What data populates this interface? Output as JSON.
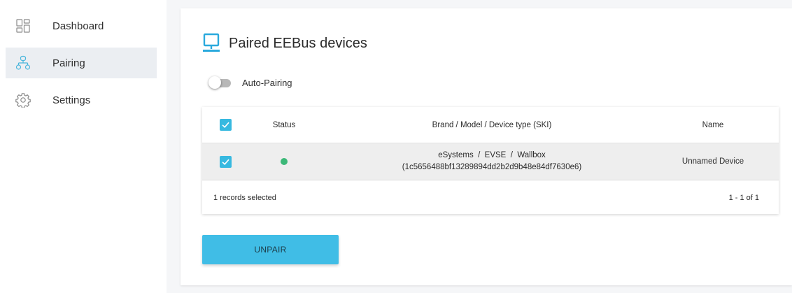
{
  "sidebar": {
    "items": [
      {
        "label": "Dashboard",
        "icon": "dashboard-icon",
        "active": false
      },
      {
        "label": "Pairing",
        "icon": "network-icon",
        "active": true
      },
      {
        "label": "Settings",
        "icon": "gear-icon",
        "active": false
      }
    ]
  },
  "main": {
    "title": "Paired EEBus devices",
    "title_icon": "monitor-icon",
    "auto_pairing": {
      "label": "Auto-Pairing",
      "enabled": false
    },
    "table": {
      "columns": [
        "Status",
        "Brand / Model / Device type (SKI)",
        "Name"
      ],
      "header_checked": true,
      "rows": [
        {
          "checked": true,
          "status_color": "#3cb878",
          "device_line1": "eSystems  /  EVSE  /  Wallbox",
          "device_line2": "(1c5656488bf13289894dd2b2d9b48e84df7630e6)",
          "name": "Unnamed Device"
        }
      ],
      "footer_selected": "1 records selected",
      "footer_pagination": "1 - 1 of 1"
    },
    "unpair_label": "UNPAIR"
  },
  "colors": {
    "accent": "#40bde6",
    "checkbox": "#37b9e0",
    "status_ok": "#3cb878",
    "active_nav_bg": "#ebeef2"
  }
}
